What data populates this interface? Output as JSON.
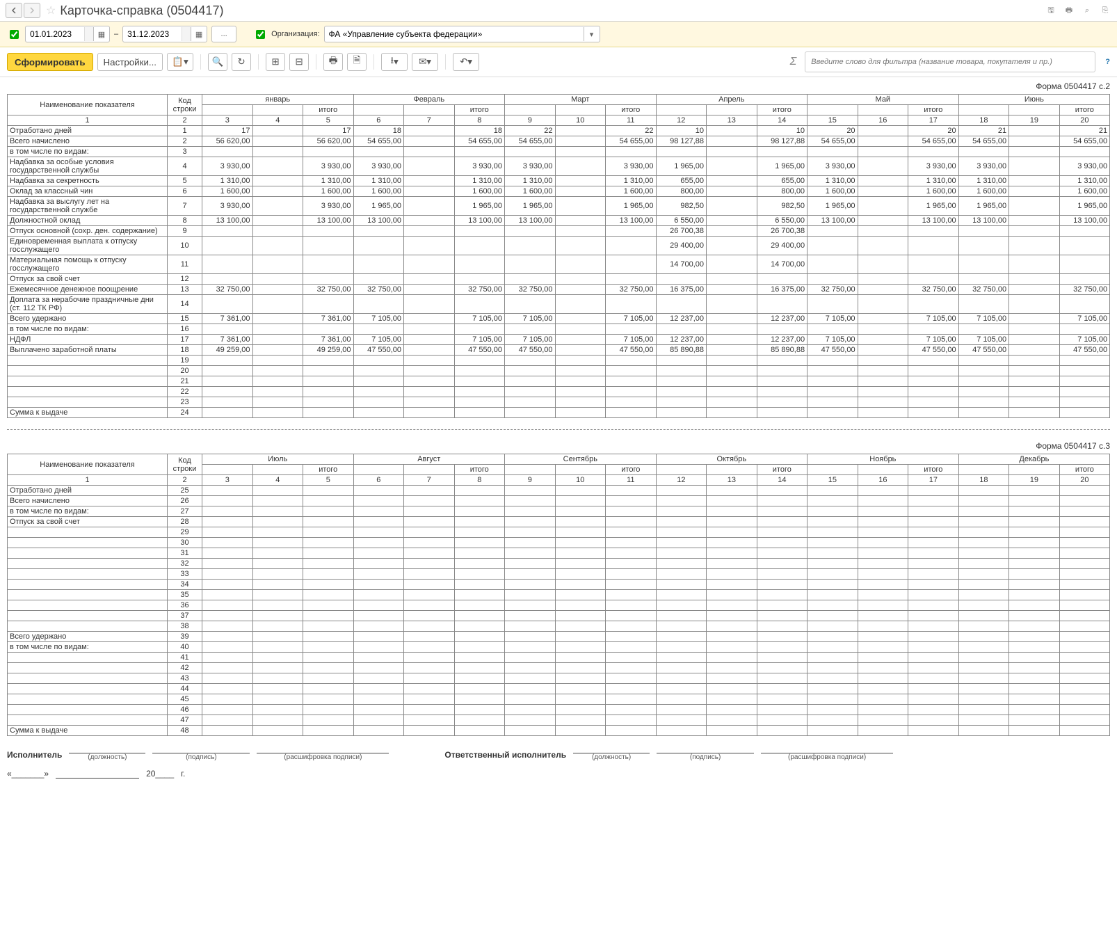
{
  "title": "Карточка-справка (0504417)",
  "period": {
    "from": "01.01.2023",
    "to": "31.12.2023",
    "sep": "–"
  },
  "org_label": "Организация:",
  "org_value": "ФА «Управление субъекта федерации»",
  "btn_run": "Сформировать",
  "btn_settings": "Настройки...",
  "filter_placeholder": "Введите слово для фильтра (название товара, покупателя и пр.)",
  "form_label_p2": "Форма 0504417 с.2",
  "form_label_p3": "Форма 0504417 с.3",
  "headers": {
    "name": "Наименование показателя",
    "code": "Код строки",
    "total": "итого",
    "months_p2": [
      "январь",
      "Февраль",
      "Март",
      "Апрель",
      "Май",
      "Июнь"
    ],
    "months_p3": [
      "Июль",
      "Август",
      "Сентябрь",
      "Октябрь",
      "Ноябрь",
      "Декабрь"
    ],
    "colnums": [
      "1",
      "2",
      "3",
      "4",
      "5",
      "6",
      "7",
      "8",
      "9",
      "10",
      "11",
      "12",
      "13",
      "14",
      "15",
      "16",
      "17",
      "18",
      "19",
      "20"
    ]
  },
  "rows2": [
    {
      "name": "Отработано дней",
      "code": "1",
      "c": [
        "17",
        "",
        "17",
        "18",
        "",
        "18",
        "22",
        "",
        "22",
        "10",
        "",
        "10",
        "20",
        "",
        "20",
        "21",
        "",
        "21"
      ]
    },
    {
      "name": "Всего начислено",
      "code": "2",
      "c": [
        "56 620,00",
        "",
        "56 620,00",
        "54 655,00",
        "",
        "54 655,00",
        "54 655,00",
        "",
        "54 655,00",
        "98 127,88",
        "",
        "98 127,88",
        "54 655,00",
        "",
        "54 655,00",
        "54 655,00",
        "",
        "54 655,00"
      ]
    },
    {
      "name": "в том числе по видам:",
      "code": "3",
      "c": [
        "",
        "",
        "",
        "",
        "",
        "",
        "",
        "",
        "",
        "",
        "",
        "",
        "",
        "",
        "",
        "",
        "",
        ""
      ]
    },
    {
      "name": "Надбавка за особые условия государственной службы",
      "code": "4",
      "c": [
        "3 930,00",
        "",
        "3 930,00",
        "3 930,00",
        "",
        "3 930,00",
        "3 930,00",
        "",
        "3 930,00",
        "1 965,00",
        "",
        "1 965,00",
        "3 930,00",
        "",
        "3 930,00",
        "3 930,00",
        "",
        "3 930,00"
      ]
    },
    {
      "name": "Надбавка за секретность",
      "code": "5",
      "c": [
        "1 310,00",
        "",
        "1 310,00",
        "1 310,00",
        "",
        "1 310,00",
        "1 310,00",
        "",
        "1 310,00",
        "655,00",
        "",
        "655,00",
        "1 310,00",
        "",
        "1 310,00",
        "1 310,00",
        "",
        "1 310,00"
      ]
    },
    {
      "name": "Оклад за классный чин",
      "code": "6",
      "c": [
        "1 600,00",
        "",
        "1 600,00",
        "1 600,00",
        "",
        "1 600,00",
        "1 600,00",
        "",
        "1 600,00",
        "800,00",
        "",
        "800,00",
        "1 600,00",
        "",
        "1 600,00",
        "1 600,00",
        "",
        "1 600,00"
      ]
    },
    {
      "name": "Надбавка за выслугу лет на государственной службе",
      "code": "7",
      "c": [
        "3 930,00",
        "",
        "3 930,00",
        "1 965,00",
        "",
        "1 965,00",
        "1 965,00",
        "",
        "1 965,00",
        "982,50",
        "",
        "982,50",
        "1 965,00",
        "",
        "1 965,00",
        "1 965,00",
        "",
        "1 965,00"
      ]
    },
    {
      "name": "Должностной оклад",
      "code": "8",
      "c": [
        "13 100,00",
        "",
        "13 100,00",
        "13 100,00",
        "",
        "13 100,00",
        "13 100,00",
        "",
        "13 100,00",
        "6 550,00",
        "",
        "6 550,00",
        "13 100,00",
        "",
        "13 100,00",
        "13 100,00",
        "",
        "13 100,00"
      ]
    },
    {
      "name": "Отпуск основной (сохр. ден. содержание)",
      "code": "9",
      "c": [
        "",
        "",
        "",
        "",
        "",
        "",
        "",
        "",
        "",
        "26 700,38",
        "",
        "26 700,38",
        "",
        "",
        "",
        "",
        "",
        ""
      ]
    },
    {
      "name": "Единовременная выплата к отпуску госслужащего",
      "code": "10",
      "c": [
        "",
        "",
        "",
        "",
        "",
        "",
        "",
        "",
        "",
        "29 400,00",
        "",
        "29 400,00",
        "",
        "",
        "",
        "",
        "",
        ""
      ]
    },
    {
      "name": "Материальная помощь к отпуску госслужащего",
      "code": "11",
      "c": [
        "",
        "",
        "",
        "",
        "",
        "",
        "",
        "",
        "",
        "14 700,00",
        "",
        "14 700,00",
        "",
        "",
        "",
        "",
        "",
        ""
      ]
    },
    {
      "name": "Отпуск за свой счет",
      "code": "12",
      "c": [
        "",
        "",
        "",
        "",
        "",
        "",
        "",
        "",
        "",
        "",
        "",
        "",
        "",
        "",
        "",
        "",
        "",
        ""
      ]
    },
    {
      "name": "Ежемесячное денежное поощрение",
      "code": "13",
      "c": [
        "32 750,00",
        "",
        "32 750,00",
        "32 750,00",
        "",
        "32 750,00",
        "32 750,00",
        "",
        "32 750,00",
        "16 375,00",
        "",
        "16 375,00",
        "32 750,00",
        "",
        "32 750,00",
        "32 750,00",
        "",
        "32 750,00"
      ]
    },
    {
      "name": "Доплата за нерабочие праздничные дни (ст. 112 ТК РФ)",
      "code": "14",
      "c": [
        "",
        "",
        "",
        "",
        "",
        "",
        "",
        "",
        "",
        "",
        "",
        "",
        "",
        "",
        "",
        "",
        "",
        ""
      ]
    },
    {
      "name": "Всего удержано",
      "code": "15",
      "c": [
        "7 361,00",
        "",
        "7 361,00",
        "7 105,00",
        "",
        "7 105,00",
        "7 105,00",
        "",
        "7 105,00",
        "12 237,00",
        "",
        "12 237,00",
        "7 105,00",
        "",
        "7 105,00",
        "7 105,00",
        "",
        "7 105,00"
      ]
    },
    {
      "name": "в том числе по видам:",
      "code": "16",
      "c": [
        "",
        "",
        "",
        "",
        "",
        "",
        "",
        "",
        "",
        "",
        "",
        "",
        "",
        "",
        "",
        "",
        "",
        ""
      ]
    },
    {
      "name": "НДФЛ",
      "code": "17",
      "c": [
        "7 361,00",
        "",
        "7 361,00",
        "7 105,00",
        "",
        "7 105,00",
        "7 105,00",
        "",
        "7 105,00",
        "12 237,00",
        "",
        "12 237,00",
        "7 105,00",
        "",
        "7 105,00",
        "7 105,00",
        "",
        "7 105,00"
      ]
    },
    {
      "name": "Выплачено заработной платы",
      "code": "18",
      "c": [
        "49 259,00",
        "",
        "49 259,00",
        "47 550,00",
        "",
        "47 550,00",
        "47 550,00",
        "",
        "47 550,00",
        "85 890,88",
        "",
        "85 890,88",
        "47 550,00",
        "",
        "47 550,00",
        "47 550,00",
        "",
        "47 550,00"
      ]
    },
    {
      "name": "",
      "code": "19",
      "c": [
        "",
        "",
        "",
        "",
        "",
        "",
        "",
        "",
        "",
        "",
        "",
        "",
        "",
        "",
        "",
        "",
        "",
        ""
      ]
    },
    {
      "name": "",
      "code": "20",
      "c": [
        "",
        "",
        "",
        "",
        "",
        "",
        "",
        "",
        "",
        "",
        "",
        "",
        "",
        "",
        "",
        "",
        "",
        ""
      ]
    },
    {
      "name": "",
      "code": "21",
      "c": [
        "",
        "",
        "",
        "",
        "",
        "",
        "",
        "",
        "",
        "",
        "",
        "",
        "",
        "",
        "",
        "",
        "",
        ""
      ]
    },
    {
      "name": "",
      "code": "22",
      "c": [
        "",
        "",
        "",
        "",
        "",
        "",
        "",
        "",
        "",
        "",
        "",
        "",
        "",
        "",
        "",
        "",
        "",
        ""
      ]
    },
    {
      "name": "",
      "code": "23",
      "c": [
        "",
        "",
        "",
        "",
        "",
        "",
        "",
        "",
        "",
        "",
        "",
        "",
        "",
        "",
        "",
        "",
        "",
        ""
      ]
    },
    {
      "name": "Сумма к выдаче",
      "code": "24",
      "c": [
        "",
        "",
        "",
        "",
        "",
        "",
        "",
        "",
        "",
        "",
        "",
        "",
        "",
        "",
        "",
        "",
        "",
        ""
      ]
    }
  ],
  "rows3": [
    {
      "name": "Отработано дней",
      "code": "25",
      "c": [
        "",
        "",
        "",
        "",
        "",
        "",
        "",
        "",
        "",
        "",
        "",
        "",
        "",
        "",
        "",
        "",
        "",
        ""
      ]
    },
    {
      "name": "Всего начислено",
      "code": "26",
      "c": [
        "",
        "",
        "",
        "",
        "",
        "",
        "",
        "",
        "",
        "",
        "",
        "",
        "",
        "",
        "",
        "",
        "",
        ""
      ]
    },
    {
      "name": "в том числе по видам:",
      "code": "27",
      "c": [
        "",
        "",
        "",
        "",
        "",
        "",
        "",
        "",
        "",
        "",
        "",
        "",
        "",
        "",
        "",
        "",
        "",
        ""
      ]
    },
    {
      "name": "Отпуск за свой счет",
      "code": "28",
      "c": [
        "",
        "",
        "",
        "",
        "",
        "",
        "",
        "",
        "",
        "",
        "",
        "",
        "",
        "",
        "",
        "",
        "",
        ""
      ]
    },
    {
      "name": "",
      "code": "29",
      "c": [
        "",
        "",
        "",
        "",
        "",
        "",
        "",
        "",
        "",
        "",
        "",
        "",
        "",
        "",
        "",
        "",
        "",
        ""
      ]
    },
    {
      "name": "",
      "code": "30",
      "c": [
        "",
        "",
        "",
        "",
        "",
        "",
        "",
        "",
        "",
        "",
        "",
        "",
        "",
        "",
        "",
        "",
        "",
        ""
      ]
    },
    {
      "name": "",
      "code": "31",
      "c": [
        "",
        "",
        "",
        "",
        "",
        "",
        "",
        "",
        "",
        "",
        "",
        "",
        "",
        "",
        "",
        "",
        "",
        ""
      ]
    },
    {
      "name": "",
      "code": "32",
      "c": [
        "",
        "",
        "",
        "",
        "",
        "",
        "",
        "",
        "",
        "",
        "",
        "",
        "",
        "",
        "",
        "",
        "",
        ""
      ]
    },
    {
      "name": "",
      "code": "33",
      "c": [
        "",
        "",
        "",
        "",
        "",
        "",
        "",
        "",
        "",
        "",
        "",
        "",
        "",
        "",
        "",
        "",
        "",
        ""
      ]
    },
    {
      "name": "",
      "code": "34",
      "c": [
        "",
        "",
        "",
        "",
        "",
        "",
        "",
        "",
        "",
        "",
        "",
        "",
        "",
        "",
        "",
        "",
        "",
        ""
      ]
    },
    {
      "name": "",
      "code": "35",
      "c": [
        "",
        "",
        "",
        "",
        "",
        "",
        "",
        "",
        "",
        "",
        "",
        "",
        "",
        "",
        "",
        "",
        "",
        ""
      ]
    },
    {
      "name": "",
      "code": "36",
      "c": [
        "",
        "",
        "",
        "",
        "",
        "",
        "",
        "",
        "",
        "",
        "",
        "",
        "",
        "",
        "",
        "",
        "",
        ""
      ]
    },
    {
      "name": "",
      "code": "37",
      "c": [
        "",
        "",
        "",
        "",
        "",
        "",
        "",
        "",
        "",
        "",
        "",
        "",
        "",
        "",
        "",
        "",
        "",
        ""
      ]
    },
    {
      "name": "",
      "code": "38",
      "c": [
        "",
        "",
        "",
        "",
        "",
        "",
        "",
        "",
        "",
        "",
        "",
        "",
        "",
        "",
        "",
        "",
        "",
        ""
      ]
    },
    {
      "name": "Всего удержано",
      "code": "39",
      "c": [
        "",
        "",
        "",
        "",
        "",
        "",
        "",
        "",
        "",
        "",
        "",
        "",
        "",
        "",
        "",
        "",
        "",
        ""
      ]
    },
    {
      "name": "в том числе по видам:",
      "code": "40",
      "c": [
        "",
        "",
        "",
        "",
        "",
        "",
        "",
        "",
        "",
        "",
        "",
        "",
        "",
        "",
        "",
        "",
        "",
        ""
      ]
    },
    {
      "name": "",
      "code": "41",
      "c": [
        "",
        "",
        "",
        "",
        "",
        "",
        "",
        "",
        "",
        "",
        "",
        "",
        "",
        "",
        "",
        "",
        "",
        ""
      ]
    },
    {
      "name": "",
      "code": "42",
      "c": [
        "",
        "",
        "",
        "",
        "",
        "",
        "",
        "",
        "",
        "",
        "",
        "",
        "",
        "",
        "",
        "",
        "",
        ""
      ]
    },
    {
      "name": "",
      "code": "43",
      "c": [
        "",
        "",
        "",
        "",
        "",
        "",
        "",
        "",
        "",
        "",
        "",
        "",
        "",
        "",
        "",
        "",
        "",
        ""
      ]
    },
    {
      "name": "",
      "code": "44",
      "c": [
        "",
        "",
        "",
        "",
        "",
        "",
        "",
        "",
        "",
        "",
        "",
        "",
        "",
        "",
        "",
        "",
        "",
        ""
      ]
    },
    {
      "name": "",
      "code": "45",
      "c": [
        "",
        "",
        "",
        "",
        "",
        "",
        "",
        "",
        "",
        "",
        "",
        "",
        "",
        "",
        "",
        "",
        "",
        ""
      ]
    },
    {
      "name": "",
      "code": "46",
      "c": [
        "",
        "",
        "",
        "",
        "",
        "",
        "",
        "",
        "",
        "",
        "",
        "",
        "",
        "",
        "",
        "",
        "",
        ""
      ]
    },
    {
      "name": "",
      "code": "47",
      "c": [
        "",
        "",
        "",
        "",
        "",
        "",
        "",
        "",
        "",
        "",
        "",
        "",
        "",
        "",
        "",
        "",
        "",
        ""
      ]
    },
    {
      "name": "Сумма к выдаче",
      "code": "48",
      "c": [
        "",
        "",
        "",
        "",
        "",
        "",
        "",
        "",
        "",
        "",
        "",
        "",
        "",
        "",
        "",
        "",
        "",
        ""
      ]
    }
  ],
  "sig": {
    "executor": "Исполнитель",
    "resp": "Ответственный исполнитель",
    "pos": "(должность)",
    "sign": "(подпись)",
    "full": "(расшифровка подписи)",
    "date_quote": "«_______»",
    "year_prefix": "20____",
    "year_suffix": "г."
  }
}
